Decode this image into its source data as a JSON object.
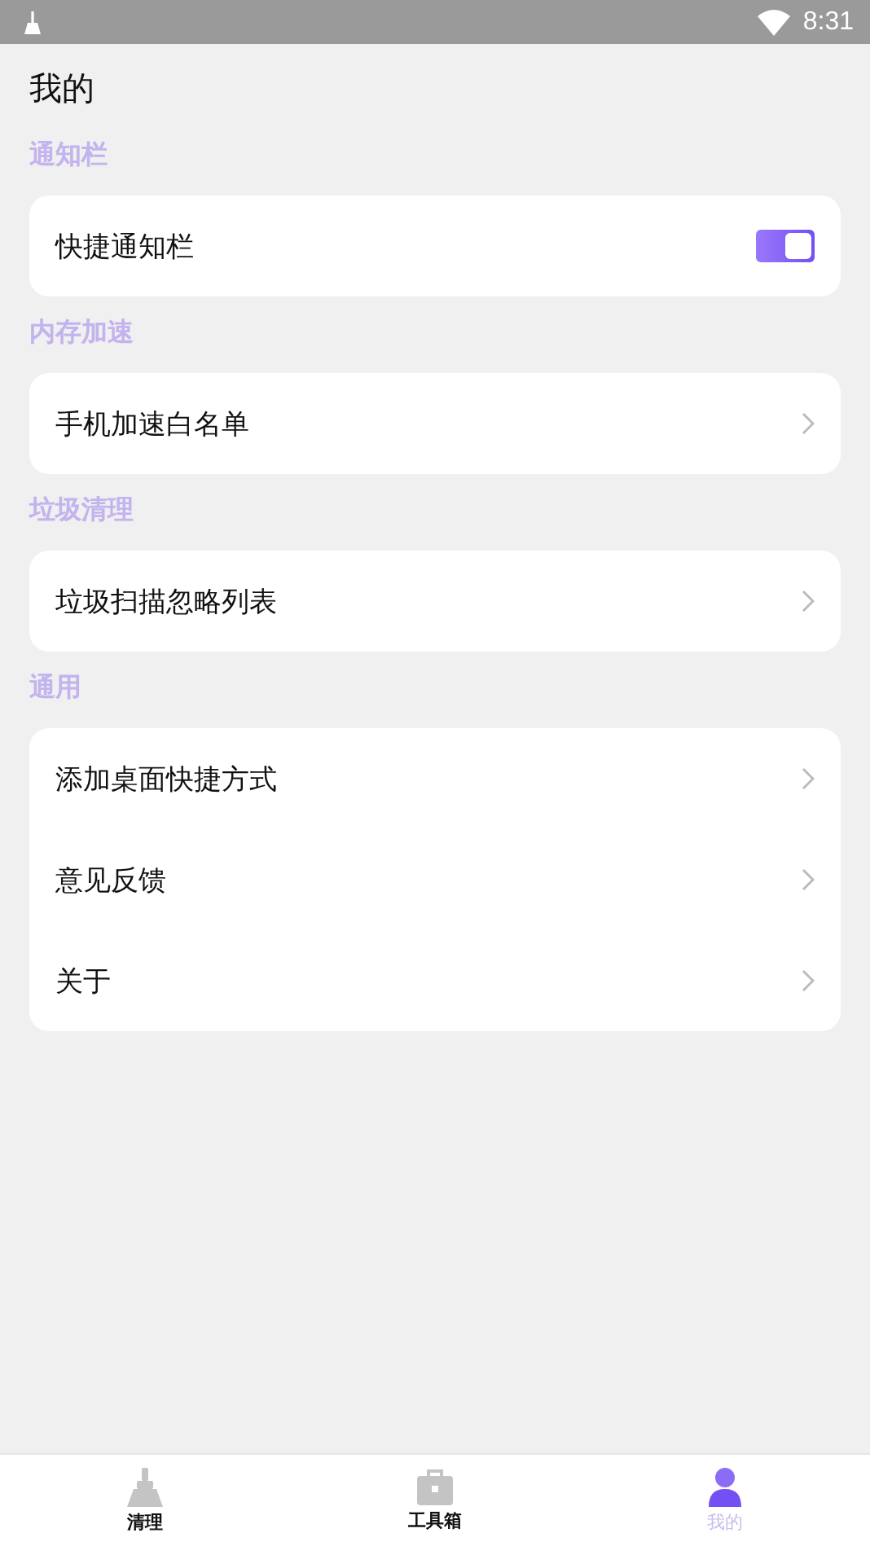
{
  "status_bar": {
    "time": "8:31"
  },
  "title": "我的",
  "sections": [
    {
      "header": "通知栏",
      "items": [
        {
          "label": "快捷通知栏",
          "kind": "toggle",
          "on": true
        }
      ]
    },
    {
      "header": "内存加速",
      "items": [
        {
          "label": "手机加速白名单",
          "kind": "link"
        }
      ]
    },
    {
      "header": "垃圾清理",
      "items": [
        {
          "label": "垃圾扫描忽略列表",
          "kind": "link"
        }
      ]
    },
    {
      "header": "通用",
      "items": [
        {
          "label": "添加桌面快捷方式",
          "kind": "link"
        },
        {
          "label": "意见反馈",
          "kind": "link"
        },
        {
          "label": "关于",
          "kind": "link"
        }
      ]
    }
  ],
  "tabs": [
    {
      "label": "清理",
      "kind": "broom",
      "selected": false
    },
    {
      "label": "工具箱",
      "kind": "toolbox",
      "selected": false
    },
    {
      "label": "我的",
      "kind": "person",
      "selected": true
    }
  ]
}
